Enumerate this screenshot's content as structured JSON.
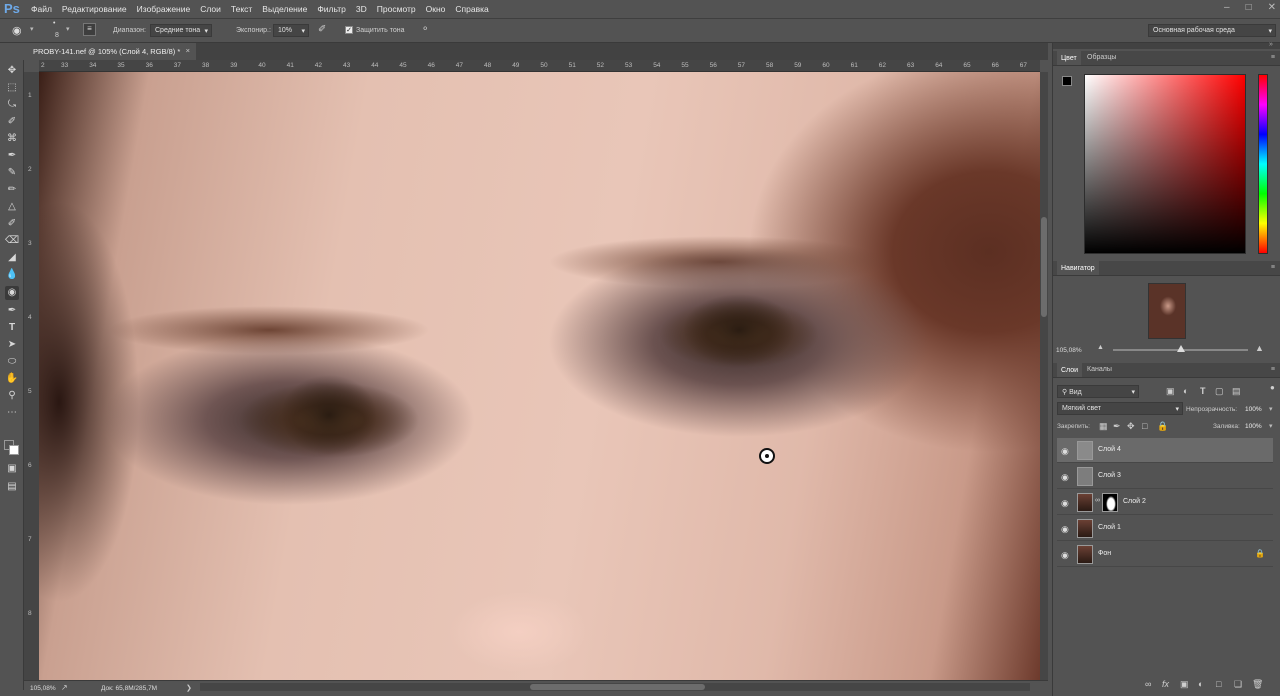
{
  "app": {
    "logo": "Ps"
  },
  "menu": [
    "Файл",
    "Редактирование",
    "Изображение",
    "Слои",
    "Текст",
    "Выделение",
    "Фильтр",
    "3D",
    "Просмотр",
    "Окно",
    "Справка"
  ],
  "options": {
    "brush_size": "8",
    "range_label": "Диапазон:",
    "range_value": "Средние тона",
    "exposure_label": "Экспониp.:",
    "exposure_value": "10%",
    "protect_tones": "Защитить тона",
    "workspace": "Основная рабочая среда"
  },
  "document": {
    "tab_title": "PROBY-141.nef @ 105% (Слой 4, RGB/8) *"
  },
  "ruler_h": [
    "2",
    "33",
    "34",
    "35",
    "36",
    "37",
    "38",
    "39",
    "40",
    "41",
    "42",
    "43",
    "44",
    "45",
    "46",
    "47",
    "48",
    "49",
    "50",
    "51",
    "52",
    "53",
    "54",
    "55",
    "56",
    "57",
    "58",
    "59",
    "60",
    "61",
    "62",
    "63",
    "64",
    "65",
    "66",
    "67"
  ],
  "ruler_v": [
    "1",
    "2",
    "3",
    "4",
    "5",
    "6",
    "7",
    "8"
  ],
  "status": {
    "zoom": "105,08%",
    "doc": "Док: 65,8M/285,7M"
  },
  "color_panel": {
    "tab_color": "Цвет",
    "tab_swatches": "Образцы",
    "fg": "#000000",
    "bg": "#ffffff"
  },
  "navigator": {
    "title": "Навигатор",
    "zoom": "105,08%"
  },
  "layers_panel": {
    "tab_layers": "Слои",
    "tab_channels": "Каналы",
    "filter_kind": "Вид",
    "blend_mode": "Мягкий свет",
    "opacity_label": "Непрозрачность:",
    "opacity_value": "100%",
    "lock_label": "Закрепить:",
    "fill_label": "Заливка:",
    "fill_value": "100%",
    "layers": [
      {
        "name": "Слой 4",
        "selected": true,
        "thumb": "gray"
      },
      {
        "name": "Слой 3",
        "selected": false,
        "thumb": "gray"
      },
      {
        "name": "Слой 2",
        "selected": false,
        "thumb": "photo-mask"
      },
      {
        "name": "Слой 1",
        "selected": false,
        "thumb": "photo"
      },
      {
        "name": "Фон",
        "selected": false,
        "thumb": "photo",
        "locked": true
      }
    ]
  }
}
